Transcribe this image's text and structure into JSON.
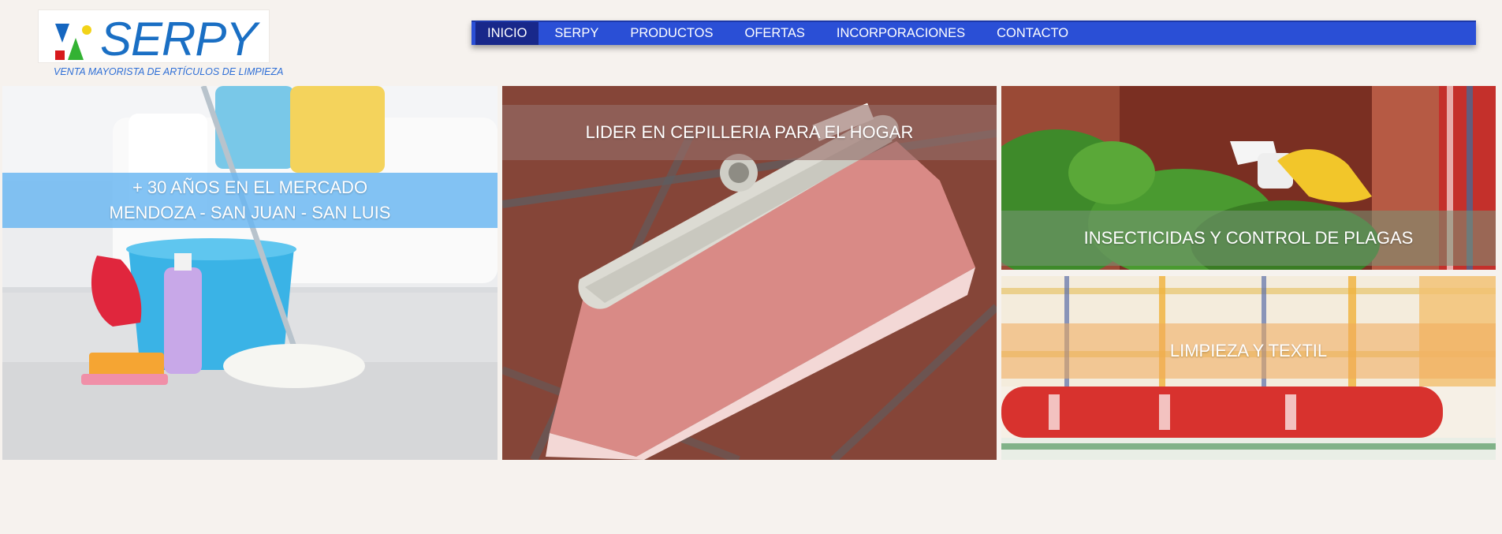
{
  "brand": {
    "name": "SERPY",
    "tagline": "VENTA MAYORISTA DE ARTÍCULOS DE LIMPIEZA"
  },
  "nav": {
    "items": [
      {
        "label": "INICIO",
        "active": true
      },
      {
        "label": "SERPY",
        "active": false
      },
      {
        "label": "PRODUCTOS",
        "active": false
      },
      {
        "label": "OFERTAS",
        "active": false
      },
      {
        "label": "INCORPORACIONES",
        "active": false
      },
      {
        "label": "CONTACTO",
        "active": false
      }
    ]
  },
  "banners": {
    "experience": {
      "line1": "+ 30 AÑOS EN EL MERCADO",
      "line2": "MENDOZA - SAN JUAN - SAN LUIS"
    },
    "brushes": {
      "label": "LIDER EN CEPILLERIA PARA EL HOGAR"
    },
    "insecticides": {
      "label": "INSECTICIDAS Y CONTROL DE PLAGAS"
    },
    "textiles": {
      "label": "LIMPIEZA Y TEXTIL"
    }
  },
  "colors": {
    "nav_bg": "#2a4fd6",
    "nav_active": "#18288a",
    "brand_blue": "#1a6fc4",
    "page_bg": "#f6f2ee"
  }
}
